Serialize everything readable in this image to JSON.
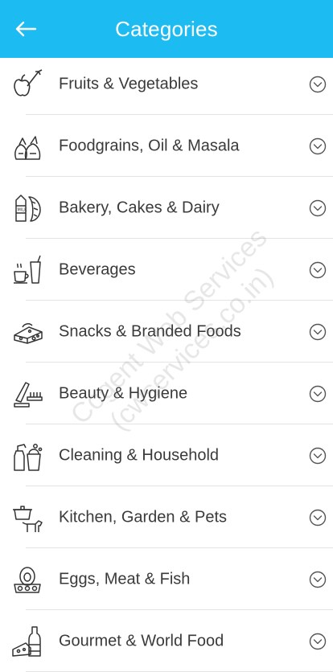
{
  "header": {
    "title": "Categories",
    "background": "#1cbcf3"
  },
  "categories": [
    {
      "label": "Fruits & Vegetables",
      "icon": "fruits-vegetables-icon"
    },
    {
      "label": "Foodgrains, Oil & Masala",
      "icon": "foodgrains-icon"
    },
    {
      "label": "Bakery, Cakes & Dairy",
      "icon": "bakery-dairy-icon"
    },
    {
      "label": "Beverages",
      "icon": "beverages-icon"
    },
    {
      "label": "Snacks & Branded Foods",
      "icon": "snacks-icon"
    },
    {
      "label": "Beauty & Hygiene",
      "icon": "beauty-hygiene-icon"
    },
    {
      "label": "Cleaning & Household",
      "icon": "cleaning-household-icon"
    },
    {
      "label": "Kitchen, Garden & Pets",
      "icon": "kitchen-garden-pets-icon"
    },
    {
      "label": "Eggs, Meat & Fish",
      "icon": "eggs-meat-fish-icon"
    },
    {
      "label": "Gourmet & World Food",
      "icon": "gourmet-world-food-icon"
    }
  ],
  "watermark": {
    "line1": "Cogent Web Services",
    "line2": "(cwservices.co.in)"
  }
}
